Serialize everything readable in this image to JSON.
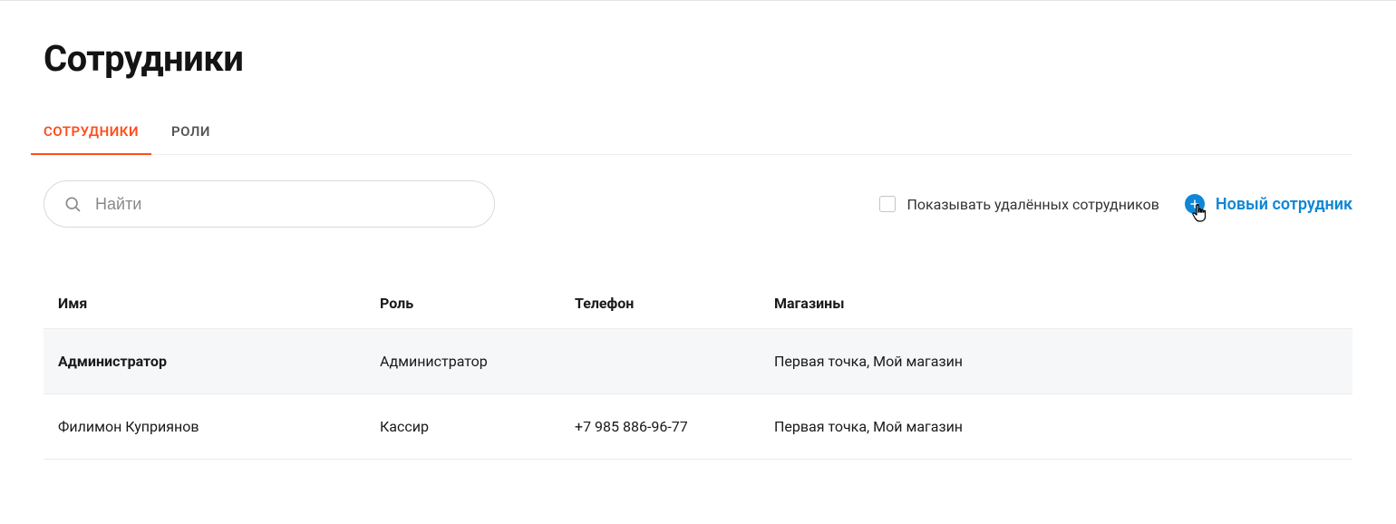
{
  "page": {
    "title": "Сотрудники"
  },
  "tabs": [
    {
      "label": "СОТРУДНИКИ",
      "active": true
    },
    {
      "label": "РОЛИ",
      "active": false
    }
  ],
  "search": {
    "placeholder": "Найти",
    "value": ""
  },
  "toolbar": {
    "show_deleted_label": "Показывать удалённых сотрудников",
    "show_deleted_checked": false,
    "new_employee_label": "Новый сотрудник"
  },
  "table": {
    "headers": {
      "name": "Имя",
      "role": "Роль",
      "phone": "Телефон",
      "shops": "Магазины"
    },
    "rows": [
      {
        "name": "Администратор",
        "role": "Администратор",
        "phone": "",
        "shops": "Первая точка, Мой магазин",
        "highlight": true
      },
      {
        "name": "Филимон Куприянов",
        "role": "Кассир",
        "phone": "+7 985 886-96-77",
        "shops": "Первая точка, Мой магазин",
        "highlight": false
      }
    ]
  }
}
